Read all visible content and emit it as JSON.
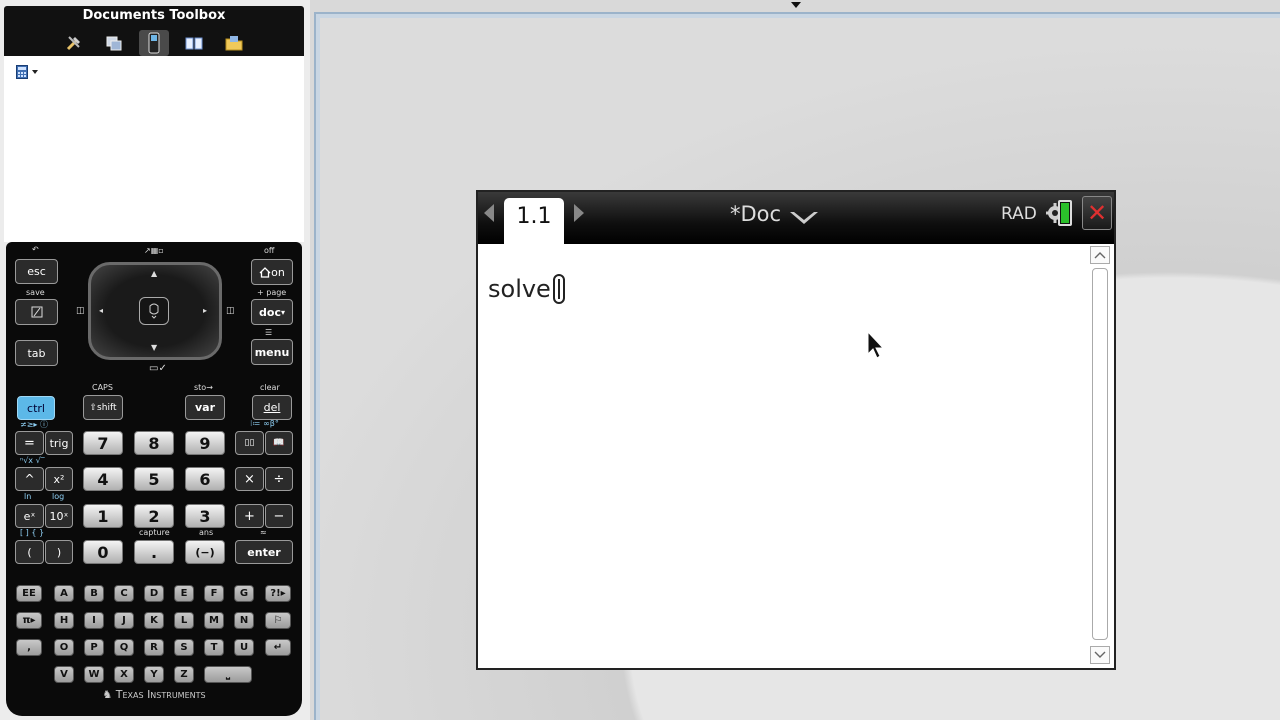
{
  "toolbox": {
    "title": "Documents Toolbox",
    "tabs": [
      {
        "icon": "tools-icon",
        "active": false
      },
      {
        "icon": "page-sorter-icon",
        "active": false
      },
      {
        "icon": "handheld-keypad-icon",
        "active": true
      },
      {
        "icon": "utilities-icon",
        "active": false
      },
      {
        "icon": "content-explorer-icon",
        "active": false
      }
    ],
    "panel_icon": "calculator-icon"
  },
  "keypad": {
    "esc": "esc",
    "on": "on",
    "on_top": "off",
    "scratch_top": "save",
    "doc": "doc",
    "doc_top": "+ page",
    "tab": "tab",
    "menu": "menu",
    "ctrl": "ctrl",
    "shift": "shift",
    "shift_top": "CAPS",
    "var": "var",
    "var_top": "sto→",
    "del": "del",
    "del_top": "clear",
    "eq": "=",
    "trig": "trig",
    "d7": "7",
    "d8": "8",
    "d9": "9",
    "d4": "4",
    "d5": "5",
    "d6": "6",
    "d1": "1",
    "d2": "2",
    "d3": "3",
    "d0": "0",
    "caret": "^",
    "x2": "x²",
    "times": "×",
    "divide": "÷",
    "ex": "eˣ",
    "tenx": "10ˣ",
    "plus": "+",
    "minus": "−",
    "ex_top": "ln",
    "tenx_top": "log",
    "lparen": "(",
    "rparen": ")",
    "dot": ".",
    "neg": "(−)",
    "enter": "enter",
    "dot_top": "capture",
    "neg_top": "ans",
    "enter_top": "≈",
    "letters": [
      "EE",
      "A",
      "B",
      "C",
      "D",
      "E",
      "F",
      "G",
      "?!▸",
      "π▸",
      "H",
      "I",
      "J",
      "K",
      "L",
      "M",
      "N",
      "⚐",
      ",",
      "O",
      "P",
      "Q",
      "R",
      "S",
      "T",
      "U",
      "↵",
      "V",
      "W",
      "X",
      "Y",
      "Z",
      "⎵"
    ],
    "brand": "Texas Instruments"
  },
  "screen": {
    "page_tab": "1.1",
    "doc_title": "*Doc",
    "angle_mode": "RAD",
    "close_label": "✕",
    "entry_text": "solve"
  },
  "battery_level": 0.9,
  "colors": {
    "ctrl_key": "#5cb8e8",
    "close_x": "#e03030",
    "battery": "#2bc02b"
  }
}
